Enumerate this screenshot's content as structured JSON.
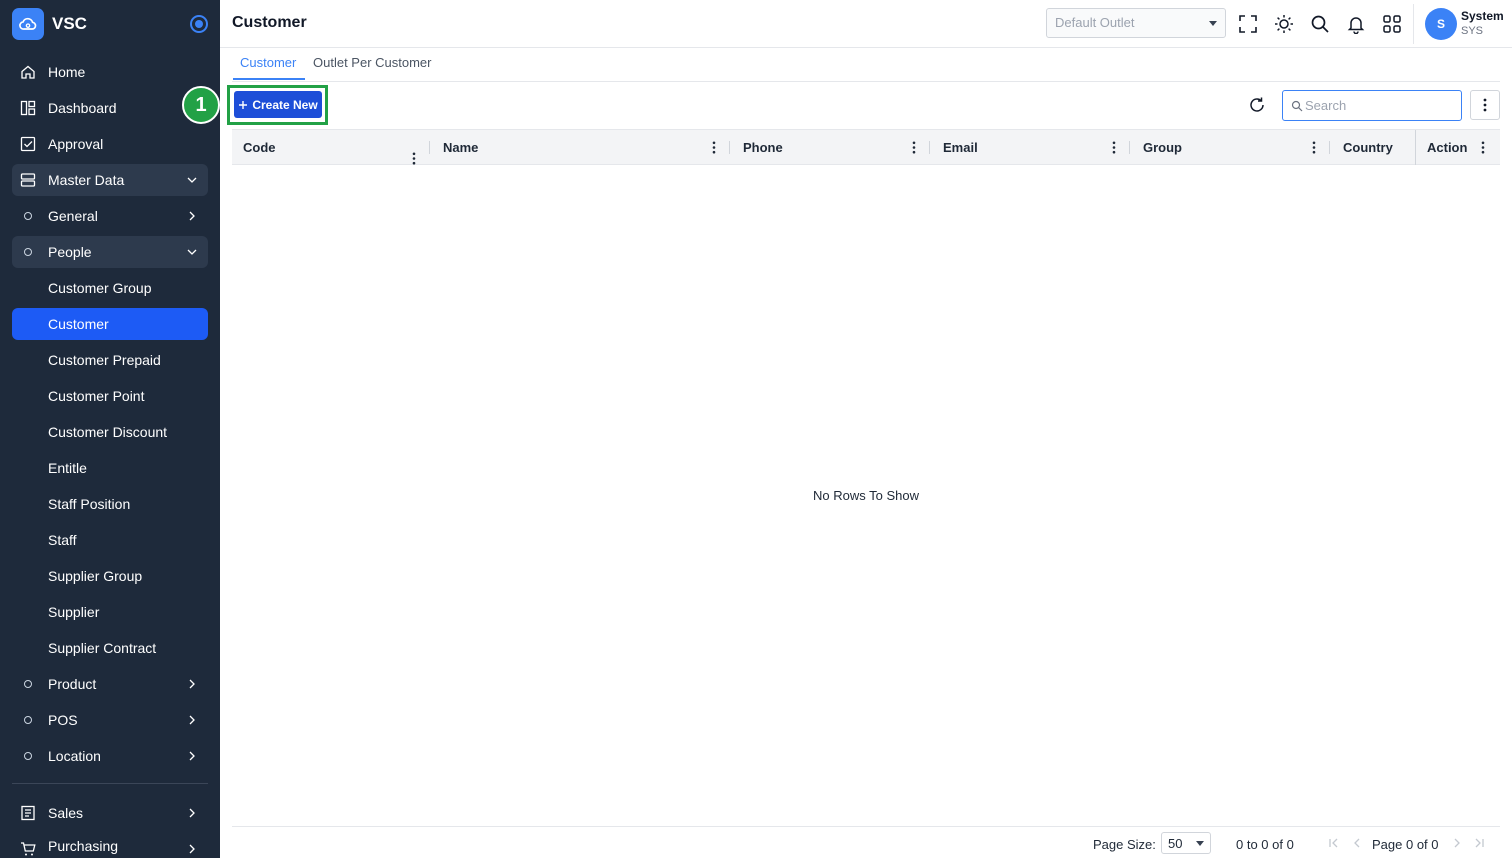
{
  "app": {
    "name": "VSC"
  },
  "sidebar": {
    "items": [
      {
        "label": "Home",
        "icon": "home-icon"
      },
      {
        "label": "Dashboard",
        "icon": "dashboard-icon"
      },
      {
        "label": "Approval",
        "icon": "approval-icon"
      },
      {
        "label": "Master Data",
        "icon": "database-icon"
      },
      {
        "label": "General"
      },
      {
        "label": "People"
      },
      {
        "label": "Customer Group"
      },
      {
        "label": "Customer"
      },
      {
        "label": "Customer Prepaid"
      },
      {
        "label": "Customer Point"
      },
      {
        "label": "Customer Discount"
      },
      {
        "label": "Entitle"
      },
      {
        "label": "Staff Position"
      },
      {
        "label": "Staff"
      },
      {
        "label": "Supplier Group"
      },
      {
        "label": "Supplier"
      },
      {
        "label": "Supplier Contract"
      },
      {
        "label": "Product"
      },
      {
        "label": "POS"
      },
      {
        "label": "Location"
      },
      {
        "label": "Sales",
        "icon": "sales-icon"
      },
      {
        "label": "Purchasing",
        "icon": "cart-icon"
      }
    ]
  },
  "header": {
    "title": "Customer",
    "outlet_placeholder": "Default Outlet",
    "user": {
      "initial": "S",
      "name": "System",
      "code": "SYS"
    }
  },
  "tabs": [
    {
      "label": "Customer",
      "active": true
    },
    {
      "label": "Outlet Per Customer",
      "active": false
    }
  ],
  "toolbar": {
    "create_label": "Create New",
    "step_badge": "1",
    "search_placeholder": "Search"
  },
  "grid": {
    "columns": [
      "Code",
      "Name",
      "Phone",
      "Email",
      "Group",
      "Country",
      "Action"
    ],
    "empty_text": "No Rows To Show"
  },
  "pagination": {
    "page_size_label": "Page Size:",
    "page_size": "50",
    "range_text": "0 to 0 of 0",
    "page_text": "Page 0 of 0"
  },
  "colors": {
    "sidebar_bg": "#1e2a3b",
    "accent": "#3b82f6",
    "active_item": "#1d5bf5",
    "highlight": "#22a146"
  }
}
